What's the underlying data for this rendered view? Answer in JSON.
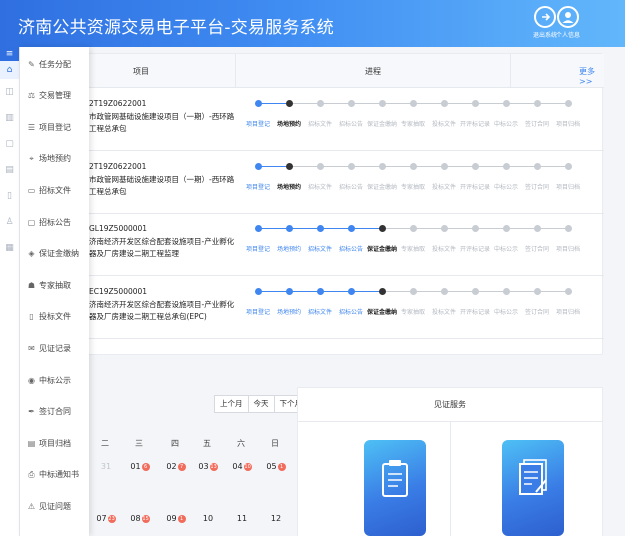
{
  "header": {
    "title": "济南公共资源交易电子平台-交易服务系统",
    "exit_label": "退出系统",
    "user_label": "个人信息"
  },
  "menu": {
    "items": [
      {
        "label": "任务分配",
        "icon": "edit-icon"
      },
      {
        "label": "交易管理",
        "icon": "gavel-icon"
      },
      {
        "label": "项目登记",
        "icon": "list-icon"
      },
      {
        "label": "场地预约",
        "icon": "location-icon"
      },
      {
        "label": "招标文件",
        "icon": "folder-icon"
      },
      {
        "label": "招标公告",
        "icon": "monitor-icon"
      },
      {
        "label": "保证金缴纳",
        "icon": "shield-icon"
      },
      {
        "label": "专家抽取",
        "icon": "graduation-icon"
      },
      {
        "label": "投标文件",
        "icon": "file-icon"
      },
      {
        "label": "见证记录",
        "icon": "note-icon"
      },
      {
        "label": "中标公示",
        "icon": "broadcast-icon"
      },
      {
        "label": "签订合同",
        "icon": "pen-icon"
      },
      {
        "label": "项目归档",
        "icon": "archive-icon"
      },
      {
        "label": "中标通知书",
        "icon": "print-icon"
      },
      {
        "label": "见证问题",
        "icon": "warning-icon"
      }
    ]
  },
  "progress_table": {
    "col_project": "项目",
    "col_progress": "进程",
    "more_label": "更多>>",
    "stage_labels": [
      "项目登记",
      "场地预约",
      "招标文件",
      "招标公告",
      "保证金缴纳",
      "专家抽取",
      "投标文件",
      "开评标记录",
      "中标公示",
      "签订合同",
      "项目归档"
    ],
    "rows": [
      {
        "code": "2T19Z0622001",
        "name": "市政管网基础设施建设项目（一期）-西环路工程总承包",
        "current": 1
      },
      {
        "code": "2T19Z0622001",
        "name": "市政管网基础设施建设项目（一期）-西环路工程总承包",
        "current": 1
      },
      {
        "code": "GL19Z5000001",
        "name": "济南经济开发区综合配套设施项目-产业孵化器及厂房建设二期工程监理",
        "current": 4
      },
      {
        "code": "EC19Z5000001",
        "name": "济南经济开发区综合配套设施项目-产业孵化器及厂房建设二期工程总承包(EPC)",
        "current": 4
      }
    ]
  },
  "calendar": {
    "prev_month": "上个月",
    "today": "今天",
    "next_month": "下个月",
    "weekdays": [
      "二",
      "三",
      "四",
      "五",
      "六",
      "日"
    ],
    "week1": [
      {
        "day": "31",
        "badge": "",
        "muted": true
      },
      {
        "day": "01",
        "badge": "6",
        "muted": false
      },
      {
        "day": "02",
        "badge": "7",
        "muted": false
      },
      {
        "day": "03",
        "badge": "13",
        "muted": false
      },
      {
        "day": "04",
        "badge": "10",
        "muted": false
      },
      {
        "day": "05",
        "badge": "1",
        "muted": false
      }
    ],
    "week2": [
      {
        "day": "07",
        "badge": "23",
        "muted": false
      },
      {
        "day": "08",
        "badge": "15",
        "muted": false
      },
      {
        "day": "09",
        "badge": "1",
        "muted": false
      },
      {
        "day": "10",
        "badge": "",
        "muted": false
      },
      {
        "day": "11",
        "badge": "",
        "muted": false
      },
      {
        "day": "12",
        "badge": "",
        "muted": false
      }
    ]
  },
  "service": {
    "title": "见证服务",
    "tiles": [
      {
        "icon": "clipboard-icon"
      },
      {
        "icon": "document-pen-icon"
      }
    ]
  },
  "colors": {
    "accent": "#3f86f0",
    "done": "#3f86f0",
    "current": "#333333",
    "pending": "#c8ccd3",
    "badge": "#f26b5b"
  }
}
